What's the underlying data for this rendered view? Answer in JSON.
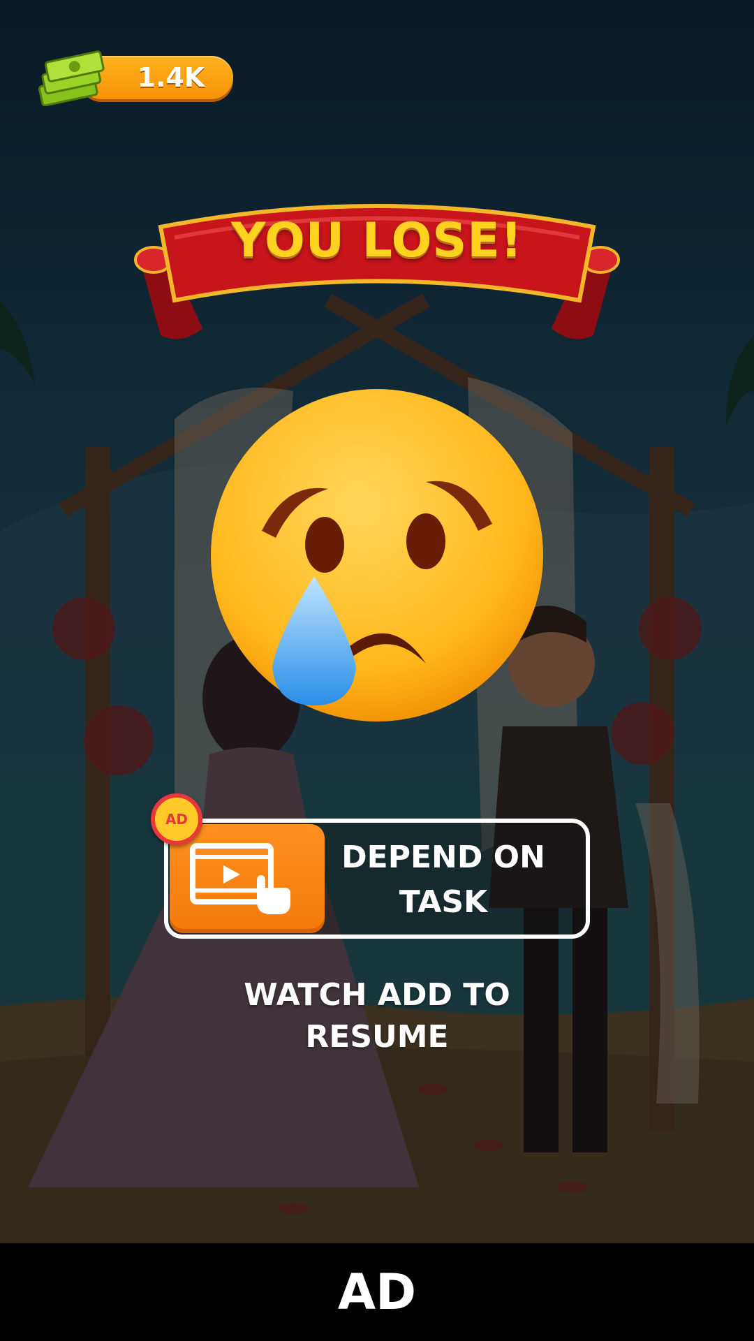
{
  "hud": {
    "money_value": "1.4K",
    "money_icon": "cash-stack-icon"
  },
  "result": {
    "title": "YOU LOSE!",
    "emoji": "crying-face-emoji"
  },
  "task": {
    "ad_badge": "AD",
    "button_icon": "video-tap-icon",
    "label": "DEPEND ON\nTASK"
  },
  "resume": {
    "text": "WATCH ADD TO\nRESUME"
  },
  "ad_bar": {
    "label": "AD"
  },
  "colors": {
    "accent_orange": "#f47a0b",
    "banner_red": "#c8141b",
    "title_gold": "#ffd21f",
    "badge_yellow": "#ffc928",
    "badge_red": "#e8383b"
  }
}
